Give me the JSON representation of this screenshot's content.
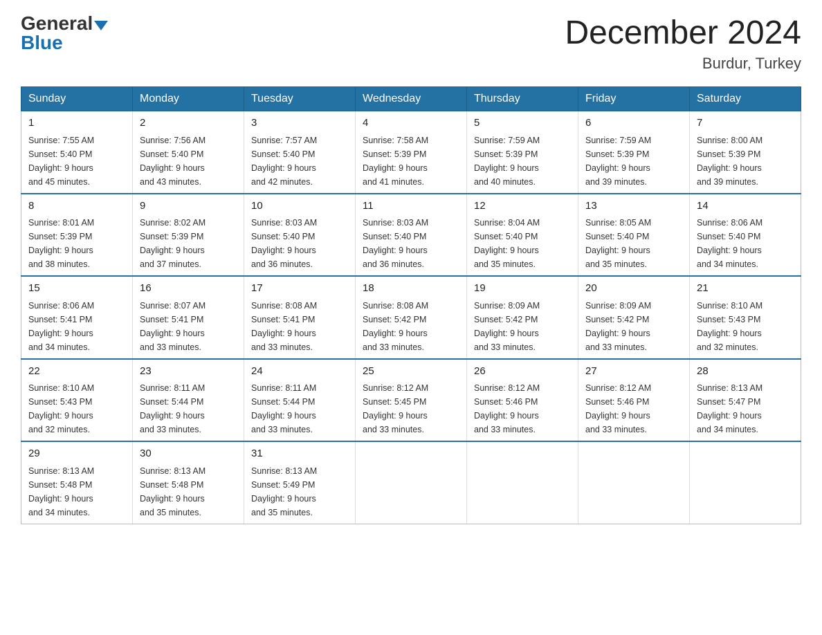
{
  "header": {
    "logo_general": "General",
    "logo_blue": "Blue",
    "month_title": "December 2024",
    "location": "Burdur, Turkey"
  },
  "weekdays": [
    "Sunday",
    "Monday",
    "Tuesday",
    "Wednesday",
    "Thursday",
    "Friday",
    "Saturday"
  ],
  "weeks": [
    [
      {
        "day": "1",
        "sunrise": "7:55 AM",
        "sunset": "5:40 PM",
        "daylight": "9 hours and 45 minutes."
      },
      {
        "day": "2",
        "sunrise": "7:56 AM",
        "sunset": "5:40 PM",
        "daylight": "9 hours and 43 minutes."
      },
      {
        "day": "3",
        "sunrise": "7:57 AM",
        "sunset": "5:40 PM",
        "daylight": "9 hours and 42 minutes."
      },
      {
        "day": "4",
        "sunrise": "7:58 AM",
        "sunset": "5:39 PM",
        "daylight": "9 hours and 41 minutes."
      },
      {
        "day": "5",
        "sunrise": "7:59 AM",
        "sunset": "5:39 PM",
        "daylight": "9 hours and 40 minutes."
      },
      {
        "day": "6",
        "sunrise": "7:59 AM",
        "sunset": "5:39 PM",
        "daylight": "9 hours and 39 minutes."
      },
      {
        "day": "7",
        "sunrise": "8:00 AM",
        "sunset": "5:39 PM",
        "daylight": "9 hours and 39 minutes."
      }
    ],
    [
      {
        "day": "8",
        "sunrise": "8:01 AM",
        "sunset": "5:39 PM",
        "daylight": "9 hours and 38 minutes."
      },
      {
        "day": "9",
        "sunrise": "8:02 AM",
        "sunset": "5:39 PM",
        "daylight": "9 hours and 37 minutes."
      },
      {
        "day": "10",
        "sunrise": "8:03 AM",
        "sunset": "5:40 PM",
        "daylight": "9 hours and 36 minutes."
      },
      {
        "day": "11",
        "sunrise": "8:03 AM",
        "sunset": "5:40 PM",
        "daylight": "9 hours and 36 minutes."
      },
      {
        "day": "12",
        "sunrise": "8:04 AM",
        "sunset": "5:40 PM",
        "daylight": "9 hours and 35 minutes."
      },
      {
        "day": "13",
        "sunrise": "8:05 AM",
        "sunset": "5:40 PM",
        "daylight": "9 hours and 35 minutes."
      },
      {
        "day": "14",
        "sunrise": "8:06 AM",
        "sunset": "5:40 PM",
        "daylight": "9 hours and 34 minutes."
      }
    ],
    [
      {
        "day": "15",
        "sunrise": "8:06 AM",
        "sunset": "5:41 PM",
        "daylight": "9 hours and 34 minutes."
      },
      {
        "day": "16",
        "sunrise": "8:07 AM",
        "sunset": "5:41 PM",
        "daylight": "9 hours and 33 minutes."
      },
      {
        "day": "17",
        "sunrise": "8:08 AM",
        "sunset": "5:41 PM",
        "daylight": "9 hours and 33 minutes."
      },
      {
        "day": "18",
        "sunrise": "8:08 AM",
        "sunset": "5:42 PM",
        "daylight": "9 hours and 33 minutes."
      },
      {
        "day": "19",
        "sunrise": "8:09 AM",
        "sunset": "5:42 PM",
        "daylight": "9 hours and 33 minutes."
      },
      {
        "day": "20",
        "sunrise": "8:09 AM",
        "sunset": "5:42 PM",
        "daylight": "9 hours and 33 minutes."
      },
      {
        "day": "21",
        "sunrise": "8:10 AM",
        "sunset": "5:43 PM",
        "daylight": "9 hours and 32 minutes."
      }
    ],
    [
      {
        "day": "22",
        "sunrise": "8:10 AM",
        "sunset": "5:43 PM",
        "daylight": "9 hours and 32 minutes."
      },
      {
        "day": "23",
        "sunrise": "8:11 AM",
        "sunset": "5:44 PM",
        "daylight": "9 hours and 33 minutes."
      },
      {
        "day": "24",
        "sunrise": "8:11 AM",
        "sunset": "5:44 PM",
        "daylight": "9 hours and 33 minutes."
      },
      {
        "day": "25",
        "sunrise": "8:12 AM",
        "sunset": "5:45 PM",
        "daylight": "9 hours and 33 minutes."
      },
      {
        "day": "26",
        "sunrise": "8:12 AM",
        "sunset": "5:46 PM",
        "daylight": "9 hours and 33 minutes."
      },
      {
        "day": "27",
        "sunrise": "8:12 AM",
        "sunset": "5:46 PM",
        "daylight": "9 hours and 33 minutes."
      },
      {
        "day": "28",
        "sunrise": "8:13 AM",
        "sunset": "5:47 PM",
        "daylight": "9 hours and 34 minutes."
      }
    ],
    [
      {
        "day": "29",
        "sunrise": "8:13 AM",
        "sunset": "5:48 PM",
        "daylight": "9 hours and 34 minutes."
      },
      {
        "day": "30",
        "sunrise": "8:13 AM",
        "sunset": "5:48 PM",
        "daylight": "9 hours and 35 minutes."
      },
      {
        "day": "31",
        "sunrise": "8:13 AM",
        "sunset": "5:49 PM",
        "daylight": "9 hours and 35 minutes."
      },
      null,
      null,
      null,
      null
    ]
  ],
  "labels": {
    "sunrise": "Sunrise: ",
    "sunset": "Sunset: ",
    "daylight": "Daylight: "
  }
}
